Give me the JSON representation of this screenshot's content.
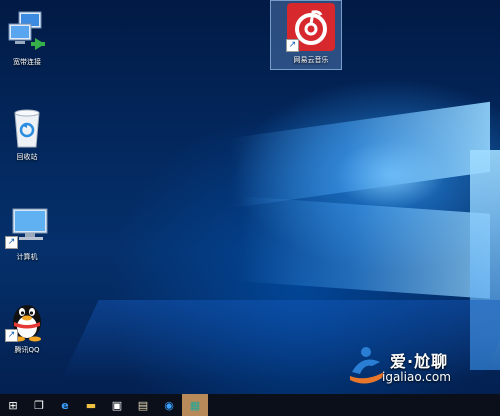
{
  "desktop": {
    "icons": [
      {
        "label": "宽带连接",
        "icon": "network-computers-icon"
      },
      {
        "label": "回收站",
        "icon": "recycle-bin-icon"
      },
      {
        "label": "计算机",
        "icon": "computer-monitor-icon"
      },
      {
        "label": "腾讯QQ",
        "icon": "qq-penguin-icon"
      },
      {
        "label": "网易云音乐",
        "icon": "netease-music-icon"
      }
    ]
  },
  "watermark": {
    "title": "爱·尬聊",
    "url": "igaliao.com"
  },
  "taskbar": {
    "buttons": [
      {
        "name": "start-button",
        "glyph": "⊞"
      },
      {
        "name": "task-view-button",
        "glyph": "❐"
      },
      {
        "name": "edge-browser-button",
        "glyph": "e"
      },
      {
        "name": "file-explorer-button",
        "glyph": "▬"
      },
      {
        "name": "store-button",
        "glyph": "▣"
      },
      {
        "name": "app-button-1",
        "glyph": "▤"
      },
      {
        "name": "app-button-2",
        "glyph": "◉"
      },
      {
        "name": "app-button-3",
        "glyph": "▦"
      }
    ]
  },
  "colors": {
    "netease_red": "#d7282d",
    "taskbar_bg": "#0a0f1a",
    "active_button": "#b88a5a"
  }
}
